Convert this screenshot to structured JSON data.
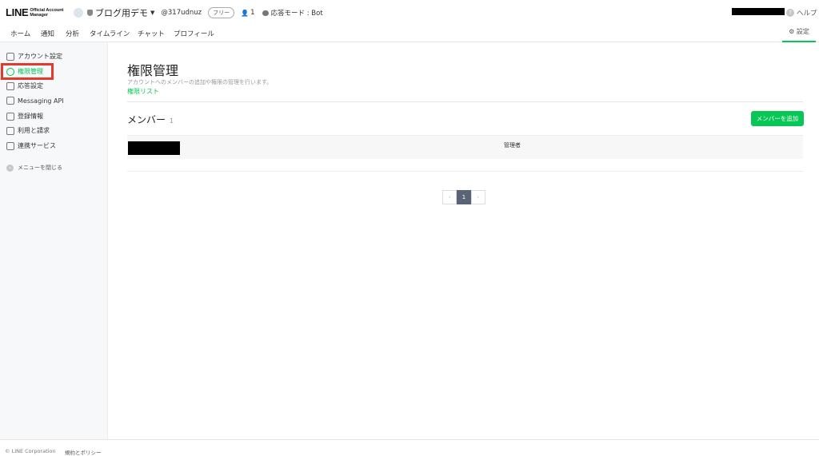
{
  "header": {
    "logo_main": "LINE",
    "logo_sub_line1": "Official Account",
    "logo_sub_line2": "Manager",
    "account_name": "ブログ用デモ",
    "account_id": "@317udnuz",
    "plan": "フリー",
    "member_count": "1",
    "response_mode": "応答モード : Bot",
    "help": "ヘルプ"
  },
  "nav": {
    "tabs": [
      "ホーム",
      "通知",
      "分析",
      "タイムライン",
      "チャット",
      "プロフィール"
    ],
    "settings": "設定"
  },
  "sidebar": {
    "items": [
      {
        "label": "アカウント設定",
        "icon": "person-icon"
      },
      {
        "label": "権限管理",
        "icon": "person-circle-icon",
        "active": true
      },
      {
        "label": "応答設定",
        "icon": "chat-reply-icon"
      },
      {
        "label": "Messaging API",
        "icon": "api-chat-icon"
      },
      {
        "label": "登録情報",
        "icon": "document-icon"
      },
      {
        "label": "利用と請求",
        "icon": "invoice-icon"
      },
      {
        "label": "連携サービス",
        "icon": "plugin-icon"
      }
    ],
    "close_menu": "メニューを閉じる",
    "accent": "#06c755",
    "highlight_color": "#e53a2a"
  },
  "main": {
    "title": "権限管理",
    "description": "アカウントへのメンバーの追加や権限の管理を行います。",
    "link": "権限リスト",
    "members_title": "メンバー",
    "members_count": "1",
    "add_button": "メンバーを追加",
    "members": [
      {
        "role": "管理者"
      }
    ],
    "pagination": {
      "prev": "‹",
      "current": "1",
      "next": "›"
    }
  },
  "footer": {
    "copyright": "© LINE Corporation",
    "policy": "規約とポリシー"
  }
}
